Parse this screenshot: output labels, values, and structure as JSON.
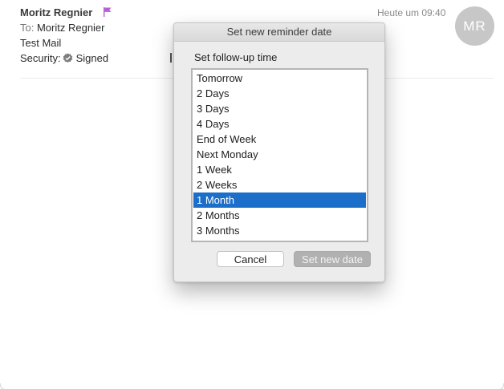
{
  "mail": {
    "sender": "Moritz Regnier",
    "to_label": "To:",
    "to_value": "Moritz Regnier",
    "subject": "Test Mail",
    "security_label": "Security:",
    "security_value": "Signed",
    "timestamp": "Heute um 09:40",
    "avatar_initials": "MR",
    "flag_color": "#b65fd6"
  },
  "dialog": {
    "title": "Set new reminder date",
    "label": "Set follow-up time",
    "options": [
      "Tomorrow",
      "2 Days",
      "3 Days",
      "4 Days",
      "End of Week",
      "Next Monday",
      "1 Week",
      "2 Weeks",
      "1 Month",
      "2 Months",
      "3 Months"
    ],
    "selected_option": "1 Month",
    "cancel_label": "Cancel",
    "confirm_label": "Set new date",
    "selection_color": "#1b6fc9"
  }
}
